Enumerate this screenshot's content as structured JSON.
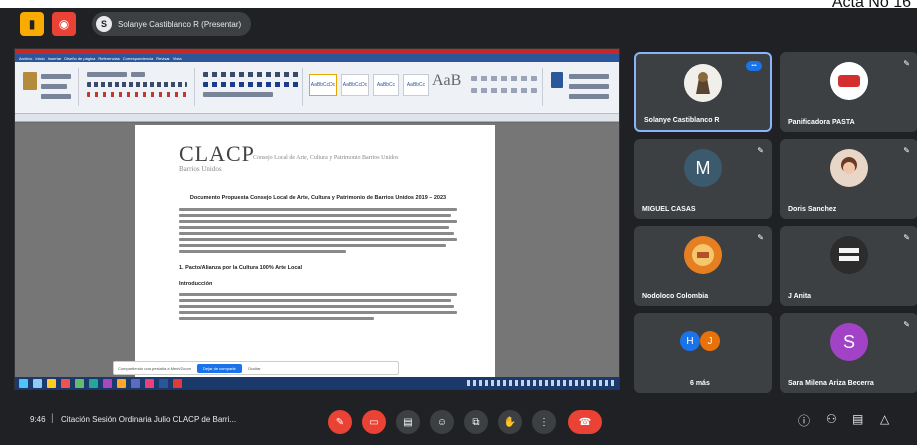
{
  "corner_label": "Acta No 16",
  "topbar": {
    "presenter_chip": "Solanye Castiblanco R (Presentar)"
  },
  "shared_screen": {
    "word_tabs": [
      "Archivo",
      "Inicio",
      "Insertar",
      "Diseño de página",
      "Referencias",
      "Correspondencia",
      "Revisar",
      "Vista"
    ],
    "style_boxes": [
      "AaBbCcDc",
      "AaBbCcDc",
      "AaBbCc",
      "AaBbCc"
    ],
    "big_style": "AaB",
    "document": {
      "logo": "CLACP",
      "logo_sub": "Barrios Unidos",
      "header_line": "Consejo Local de Arte, Cultura y Patrimonio Barrios Unidos",
      "title": "Documento Propuesta Consejo Local de Arte, Cultura y Patrimonio de Barrios Unidos 2019 – 2023",
      "section1": "1.   Pacto/Alianza por la Cultura 100% Arte Local",
      "section2": "Introducción"
    },
    "toolbar": {
      "hint": "Compartiendo una pestaña a Meet/Zoom",
      "primary_button": "Dejar de compartir",
      "secondary_button": "Ocultar"
    }
  },
  "participants": [
    {
      "name": "Solanye Castiblanco R",
      "initial": "",
      "color": "#e8eaed",
      "active": true
    },
    {
      "name": "Panificadora PASTA",
      "initial": "",
      "color": "#ffffff",
      "active": false
    },
    {
      "name": "MIGUEL CASAS",
      "initial": "M",
      "color": "#3c5a6e",
      "active": false
    },
    {
      "name": "Doris Sanchez",
      "initial": "",
      "color": "#c8a089",
      "active": false
    },
    {
      "name": "Nodoloco Colombia",
      "initial": "",
      "color": "#e67e22",
      "active": false
    },
    {
      "name": "J Anita",
      "initial": "",
      "color": "#2c2c2c",
      "active": false
    },
    {
      "name": "6 más",
      "initial": "",
      "color": "",
      "active": false
    },
    {
      "name": "Sara Milena Ariza Becerra",
      "initial": "S",
      "color": "#a142c7",
      "active": false
    }
  ],
  "more_avatars": [
    {
      "initial": "H",
      "color": "#1a73e8"
    },
    {
      "initial": "J",
      "color": "#e8710a"
    }
  ],
  "bottom_bar": {
    "time": "9:46",
    "separator": "|",
    "title": "Citación Sesión Ordinaria Julio CLACP de Barri..."
  },
  "colors": {
    "accent": "#1a73e8",
    "danger": "#ea4335",
    "tile_bg": "#3c4043",
    "page_bg": "#202124"
  }
}
